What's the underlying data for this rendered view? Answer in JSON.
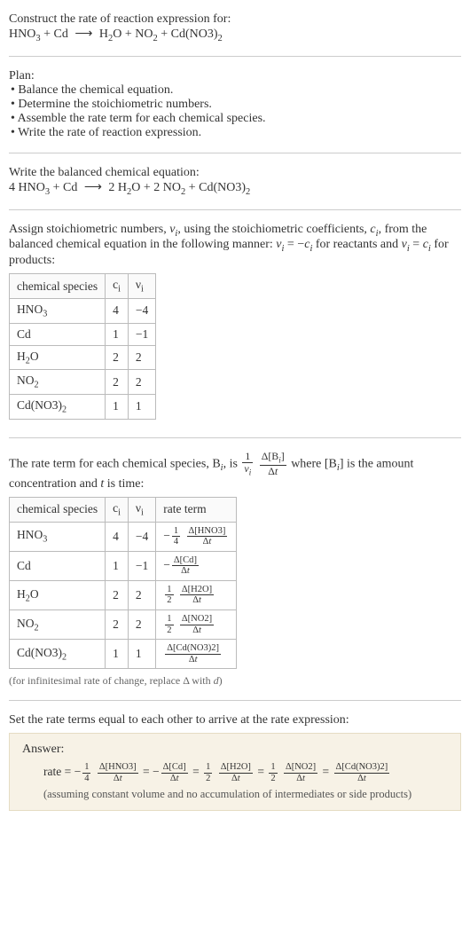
{
  "header": {
    "title": "Construct the rate of reaction expression for:",
    "equation_html": "HNO<sub>3</sub> + Cd <span class=\"arrow\">⟶</span> H<sub>2</sub>O + NO<sub>2</sub> + Cd(NO3)<sub>2</sub>"
  },
  "plan": {
    "title": "Plan:",
    "items": [
      "Balance the chemical equation.",
      "Determine the stoichiometric numbers.",
      "Assemble the rate term for each chemical species.",
      "Write the rate of reaction expression."
    ]
  },
  "balanced": {
    "title": "Write the balanced chemical equation:",
    "equation_html": "4 HNO<sub>3</sub> + Cd <span class=\"arrow\">⟶</span> 2 H<sub>2</sub>O + 2 NO<sub>2</sub> + Cd(NO3)<sub>2</sub>"
  },
  "stoich": {
    "intro_html": "Assign stoichiometric numbers, <span class=\"ital\">ν<sub>i</sub></span>, using the stoichiometric coefficients, <span class=\"ital\">c<sub>i</sub></span>, from the balanced chemical equation in the following manner: <span class=\"ital\">ν<sub>i</sub></span> = −<span class=\"ital\">c<sub>i</sub></span> for reactants and <span class=\"ital\">ν<sub>i</sub></span> = <span class=\"ital\">c<sub>i</sub></span> for products:",
    "headers": {
      "species": "chemical species",
      "ci": "c<sub>i</sub>",
      "vi": "ν<sub>i</sub>"
    },
    "rows": [
      {
        "species": "HNO<sub>3</sub>",
        "ci": "4",
        "vi": "−4"
      },
      {
        "species": "Cd",
        "ci": "1",
        "vi": "−1"
      },
      {
        "species": "H<sub>2</sub>O",
        "ci": "2",
        "vi": "2"
      },
      {
        "species": "NO<sub>2</sub>",
        "ci": "2",
        "vi": "2"
      },
      {
        "species": "Cd(NO3)<sub>2</sub>",
        "ci": "1",
        "vi": "1"
      }
    ]
  },
  "rateterm": {
    "intro_html": "The rate term for each chemical species, B<sub><span class=\"ital\">i</span></sub>, is <span class=\"frac\"><span class=\"num\">1</span><span class=\"den\"><span class=\"ital\">ν<sub>i</sub></span></span></span> <span class=\"frac\"><span class=\"num\">Δ[B<sub><span class=\"ital\">i</span></sub>]</span><span class=\"den\">Δ<span class=\"ital\">t</span></span></span> where [B<sub><span class=\"ital\">i</span></sub>] is the amount concentration and <span class=\"ital\">t</span> is time:",
    "headers": {
      "species": "chemical species",
      "ci": "c<sub>i</sub>",
      "vi": "ν<sub>i</sub>",
      "rate": "rate term"
    },
    "rows": [
      {
        "species": "HNO<sub>3</sub>",
        "ci": "4",
        "vi": "−4",
        "rate": "−<span class=\"frac smallfrac\"><span class=\"num\">1</span><span class=\"den\">4</span></span> <span class=\"frac smallfrac\"><span class=\"num\">Δ[HNO3]</span><span class=\"den\">Δ<span class=\"ital\">t</span></span></span>"
      },
      {
        "species": "Cd",
        "ci": "1",
        "vi": "−1",
        "rate": "−<span class=\"frac smallfrac\"><span class=\"num\">Δ[Cd]</span><span class=\"den\">Δ<span class=\"ital\">t</span></span></span>"
      },
      {
        "species": "H<sub>2</sub>O",
        "ci": "2",
        "vi": "2",
        "rate": "<span class=\"frac smallfrac\"><span class=\"num\">1</span><span class=\"den\">2</span></span> <span class=\"frac smallfrac\"><span class=\"num\">Δ[H2O]</span><span class=\"den\">Δ<span class=\"ital\">t</span></span></span>"
      },
      {
        "species": "NO<sub>2</sub>",
        "ci": "2",
        "vi": "2",
        "rate": "<span class=\"frac smallfrac\"><span class=\"num\">1</span><span class=\"den\">2</span></span> <span class=\"frac smallfrac\"><span class=\"num\">Δ[NO2]</span><span class=\"den\">Δ<span class=\"ital\">t</span></span></span>"
      },
      {
        "species": "Cd(NO3)<sub>2</sub>",
        "ci": "1",
        "vi": "1",
        "rate": "<span class=\"frac smallfrac\"><span class=\"num\">Δ[Cd(NO3)2]</span><span class=\"den\">Δ<span class=\"ital\">t</span></span></span>"
      }
    ],
    "note_html": "(for infinitesimal rate of change, replace Δ with <span class=\"ital\">d</span>)"
  },
  "final": {
    "intro": "Set the rate terms equal to each other to arrive at the rate expression:",
    "answer_label": "Answer:",
    "rate_html": "rate = −<span class=\"frac smallfrac\"><span class=\"num\">1</span><span class=\"den\">4</span></span> <span class=\"frac smallfrac\"><span class=\"num\">Δ[HNO3]</span><span class=\"den\">Δ<span class=\"ital\">t</span></span></span> = −<span class=\"frac smallfrac\"><span class=\"num\">Δ[Cd]</span><span class=\"den\">Δ<span class=\"ital\">t</span></span></span> = <span class=\"frac smallfrac\"><span class=\"num\">1</span><span class=\"den\">2</span></span> <span class=\"frac smallfrac\"><span class=\"num\">Δ[H2O]</span><span class=\"den\">Δ<span class=\"ital\">t</span></span></span> = <span class=\"frac smallfrac\"><span class=\"num\">1</span><span class=\"den\">2</span></span> <span class=\"frac smallfrac\"><span class=\"num\">Δ[NO2]</span><span class=\"den\">Δ<span class=\"ital\">t</span></span></span> = <span class=\"frac smallfrac\"><span class=\"num\">Δ[Cd(NO3)2]</span><span class=\"den\">Δ<span class=\"ital\">t</span></span></span>",
    "assume": "(assuming constant volume and no accumulation of intermediates or side products)"
  }
}
